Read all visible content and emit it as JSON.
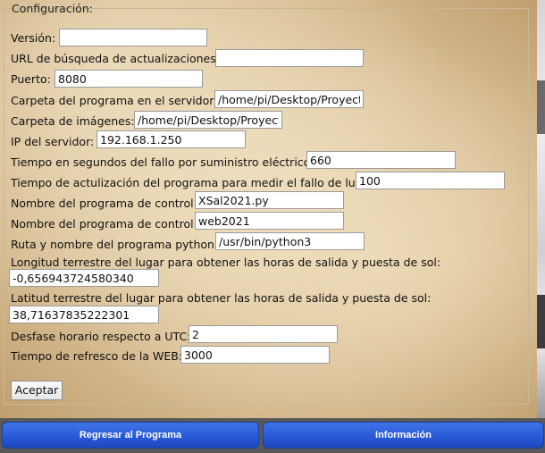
{
  "config": {
    "legend": "Configuración:",
    "fields": [
      {
        "label": "Versión:",
        "value": ""
      },
      {
        "label": "URL de búsqueda de actualizaciones:",
        "value": ""
      },
      {
        "label": "Puerto:",
        "value": "8080"
      },
      {
        "label": "Carpeta del programa en el servidor:",
        "value": "/home/pi/Desktop/Proyect"
      },
      {
        "label": "Carpeta de imágenes:",
        "value": "/home/pi/Desktop/Proyect"
      },
      {
        "label": "IP del servidor:",
        "value": "192.168.1.250"
      },
      {
        "label": "Tiempo en segundos del fallo por suministro eléctrico:",
        "value": "660"
      },
      {
        "label": "Tiempo de actulización del programa para medir el fallo de luz:",
        "value": "100"
      },
      {
        "label": "Nombre del programa de control:",
        "value": "XSal2021.py"
      },
      {
        "label": "Nombre del programa de control:",
        "value": "web2021"
      },
      {
        "label": "Ruta y nombre del programa python:",
        "value": "/usr/bin/python3"
      },
      {
        "label": "Longitud terrestre del lugar para obtener las horas de salida y puesta de sol:",
        "value": "-0,656943724580340"
      },
      {
        "label": "Latitud terrestre del lugar para obtener las horas de salida y puesta de sol:",
        "value": "38,71637835222301"
      },
      {
        "label": "Desfase horario respecto a UTC:",
        "value": "2"
      },
      {
        "label": "Tiempo de refresco de la WEB:",
        "value": "3000"
      }
    ],
    "accept_label": "Aceptar"
  },
  "nav": {
    "back_label": "Regresar al Programa",
    "info_label": "Información"
  }
}
